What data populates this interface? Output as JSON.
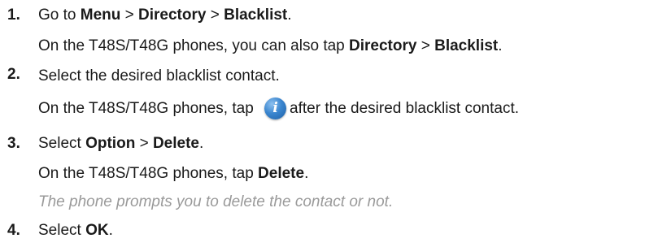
{
  "steps": [
    {
      "number": "1.",
      "line1": {
        "a": "Go to ",
        "b": "Menu",
        "c": " > ",
        "d": "Directory",
        "e": " > ",
        "f": "Blacklist",
        "g": "."
      },
      "line2": {
        "a": "On the T48S/T48G phones, you can also tap ",
        "b": "Directory",
        "c": " > ",
        "d": "Blacklist",
        "e": "."
      }
    },
    {
      "number": "2.",
      "line1": "Select the desired blacklist contact.",
      "line2": {
        "before": "On the T48S/T48G phones, tap ",
        "icon": "info-icon",
        "after": "after the desired blacklist contact."
      }
    },
    {
      "number": "3.",
      "line1": {
        "a": "Select ",
        "b": "Option",
        "c": " > ",
        "d": "Delete",
        "e": "."
      },
      "line2": {
        "a": "On the T48S/T48G phones, tap ",
        "b": "Delete",
        "c": "."
      },
      "note": "The phone prompts you to delete the contact or not."
    },
    {
      "number": "4.",
      "line1": {
        "a": "Select ",
        "b": "OK",
        "c": "."
      }
    }
  ],
  "colors": {
    "text": "#1a1a1a",
    "note": "#9a9a9a",
    "icon": "#3b86cf"
  }
}
